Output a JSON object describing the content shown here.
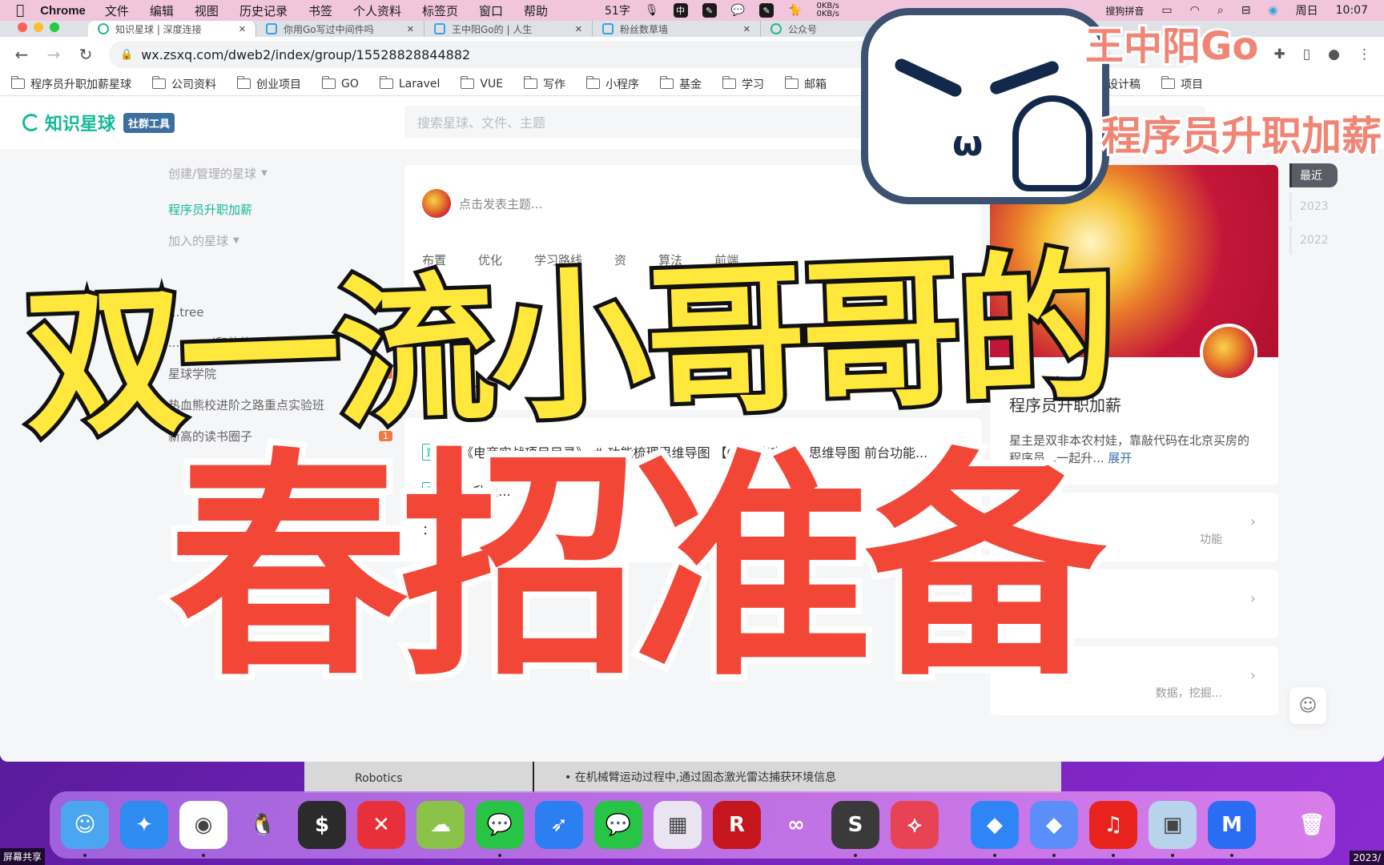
{
  "menubar": {
    "app_name": "Chrome",
    "items": [
      "文件",
      "编辑",
      "视图",
      "历史记录",
      "书签",
      "个人资料",
      "标签页",
      "窗口",
      "帮助"
    ],
    "word_count": "51字",
    "input_method": "中",
    "net_up": "0KB/s",
    "net_down": "0KB/s",
    "ime_label": "搜狗拼音",
    "day": "周日",
    "time": "10:07"
  },
  "tabs": [
    {
      "title": "知识星球 | 深度连接",
      "active": true
    },
    {
      "title": "你用Go写过中间件吗",
      "active": false
    },
    {
      "title": "王中阳Go的 | 人生",
      "active": false
    },
    {
      "title": "粉丝数草墙",
      "active": false
    },
    {
      "title": "公众号",
      "active": false
    }
  ],
  "omnibox": {
    "url": "wx.zsxq.com/dweb2/index/group/15528828844882"
  },
  "bookmarks": [
    "程序员升职加薪星球",
    "公司资料",
    "创业项目",
    "GO",
    "Laravel",
    "VUE",
    "写作",
    "小程序",
    "基金",
    "学习",
    "邮箱",
    "",
    "设计稿",
    "项目"
  ],
  "site": {
    "logo": "知识星球",
    "badge": "社群工具",
    "search_placeholder": "搜索星球、文件、主题"
  },
  "sidebar": {
    "created_header": "创建/管理的星球",
    "active_group": "程序员升职加薪",
    "joined_header": "加入的星球",
    "groups": [
      {
        "name": "...tree",
        "count": ""
      },
      {
        "name": "...ngwei和他的朋友们（限免）",
        "count": ""
      },
      {
        "name": "星球学院",
        "count": "2"
      },
      {
        "name": "热血熊校进阶之路重点实验班",
        "count": ""
      },
      {
        "name": "新高的读书圈子",
        "count": "1"
      }
    ]
  },
  "feed": {
    "composer_placeholder": "点击发表主题...",
    "tags": [
      "布置",
      "优化",
      "学习路线",
      "资",
      "算法",
      "前端"
    ],
    "posts": [
      {
        "pin": "置顶",
        "text": "《电商实战项目目录》 # 功能梳理思维导图 【Go电商实战】思维导图 前台功能..."
      },
      {
        "pin": "置顶",
        "text": "...升职..."
      },
      {
        "pin": "",
        "text": "：带..."
      }
    ]
  },
  "group_card": {
    "name": "程序员升职加薪",
    "description": "星主是双非本农村娃，靠敲代码在北京买房的程序员...一起升...",
    "expand": "展开",
    "rows": [
      {
        "hint": "功能"
      },
      {
        "hint": ""
      },
      {
        "hint": "数据，挖掘..."
      }
    ]
  },
  "timeline": {
    "active": "最近",
    "years": [
      "2023",
      "2022"
    ]
  },
  "behind_window": {
    "left_text": "Robotics",
    "bullet": "在机械臂运动过程中,通过固态激光雷达捕获环境信息"
  },
  "dock": {
    "apps": [
      {
        "name": "finder",
        "color": "#4aa6f0",
        "glyph": "☺"
      },
      {
        "name": "safari",
        "color": "#2e8bf0",
        "glyph": "✦"
      },
      {
        "name": "chrome",
        "color": "#ffffff",
        "glyph": "◉"
      },
      {
        "name": "qq",
        "color": "transparent",
        "glyph": "🐧"
      },
      {
        "name": "terminal",
        "color": "#2b2b2b",
        "glyph": "$"
      },
      {
        "name": "xmind",
        "color": "#e8303a",
        "glyph": "✕"
      },
      {
        "name": "cloud-sync",
        "color": "#8bc34a",
        "glyph": "☁"
      },
      {
        "name": "wechat",
        "color": "#28c445",
        "glyph": "💬"
      },
      {
        "name": "lark",
        "color": "#2b7ff0",
        "glyph": "➶"
      },
      {
        "name": "wechat-work",
        "color": "#28c445",
        "glyph": "💬"
      },
      {
        "name": "launchpad",
        "color": "#e8e4f2",
        "glyph": "▦"
      },
      {
        "name": "rdm",
        "color": "#c4161c",
        "glyph": "R"
      },
      {
        "name": "navicat",
        "color": "transparent",
        "glyph": "∞"
      },
      {
        "name": "sublime",
        "color": "#3a3a3a",
        "glyph": "S"
      },
      {
        "name": "xmind-red",
        "color": "#e84355",
        "glyph": "⟡"
      },
      {
        "name": "editor-1",
        "color": "#2f85f5",
        "glyph": "◆"
      },
      {
        "name": "editor-2",
        "color": "#5b8ef8",
        "glyph": "◆"
      },
      {
        "name": "netease-music",
        "color": "#e8221c",
        "glyph": "♫"
      },
      {
        "name": "preview",
        "color": "#b8d4ec",
        "glyph": "▣"
      },
      {
        "name": "tencent-meeting",
        "color": "#2a6df2",
        "glyph": "M"
      },
      {
        "name": "trash",
        "color": "transparent",
        "glyph": "🗑"
      }
    ]
  },
  "corner_labels": {
    "left": "屏幕共享",
    "right": "2023/"
  },
  "overlay": {
    "title_line1": "双一流小哥哥的",
    "title_line2": "春招准备",
    "brand_line1": "王中阳Go",
    "brand_line2": "程序员升职加薪"
  }
}
